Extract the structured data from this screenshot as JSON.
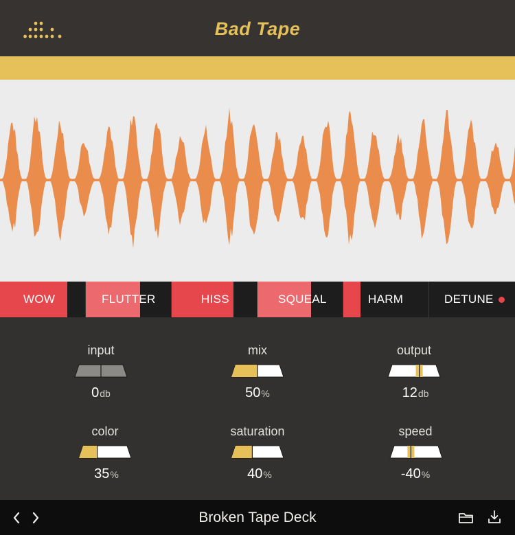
{
  "app": {
    "title": "Bad Tape"
  },
  "icons": {
    "logo": "dot-grid-logo",
    "prev": "chevron-left-icon",
    "next": "chevron-right-icon",
    "folder": "folder-icon",
    "download": "download-icon"
  },
  "colors": {
    "accent": "#e6c15a",
    "waveform": "#e98c4c",
    "effect_active": "#e5474c",
    "effect_partial": "#ec6a6d",
    "background": "#333130"
  },
  "effects": [
    {
      "label": "WOW",
      "state": "active"
    },
    {
      "label": "FLUTTER",
      "state": "partial"
    },
    {
      "label": "HISS",
      "state": "active"
    },
    {
      "label": "SQUEAL",
      "state": "partial"
    },
    {
      "label": "HARM",
      "state": "partial"
    },
    {
      "label": "DETUNE",
      "state": "off"
    }
  ],
  "knobs": [
    {
      "label": "input",
      "value": "0",
      "unit": "db",
      "level": 0.5,
      "style": "gray"
    },
    {
      "label": "mix",
      "value": "50",
      "unit": "%",
      "level": 0.5,
      "style": "fill"
    },
    {
      "label": "output",
      "value": "12",
      "unit": "db",
      "level": 0.6,
      "style": "center"
    },
    {
      "label": "color",
      "value": "35",
      "unit": "%",
      "level": 0.35,
      "style": "fill"
    },
    {
      "label": "saturation",
      "value": "40",
      "unit": "%",
      "level": 0.4,
      "style": "fill"
    },
    {
      "label": "speed",
      "value": "-40",
      "unit": "%",
      "level": 0.4,
      "style": "center"
    }
  ],
  "footer": {
    "preset": "Broken Tape Deck"
  }
}
